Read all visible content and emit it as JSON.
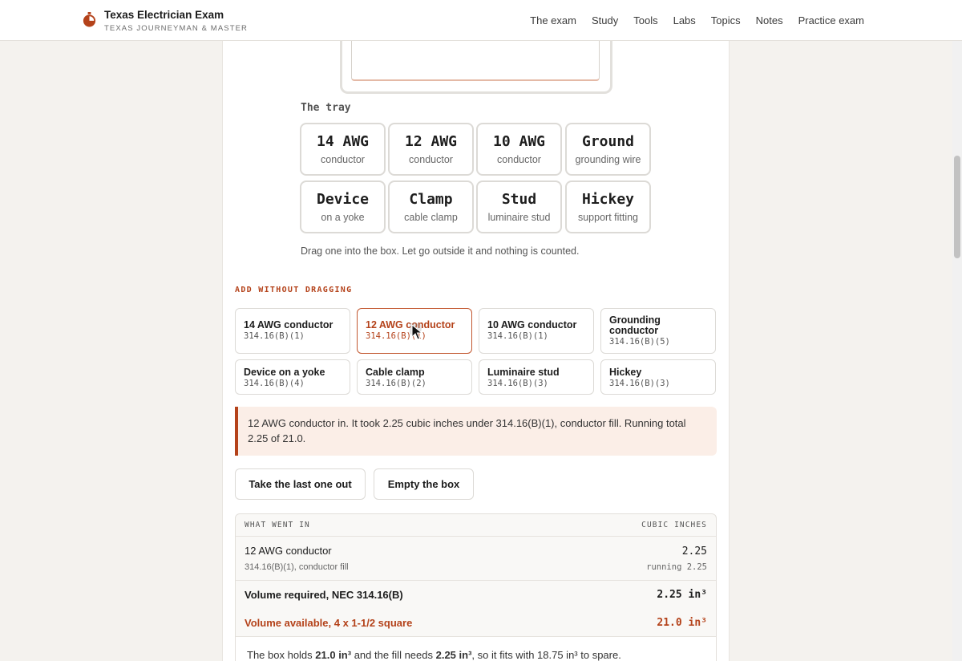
{
  "header": {
    "title": "Texas Electrician Exam",
    "subtitle": "TEXAS JOURNEYMAN & MASTER",
    "nav": [
      "The exam",
      "Study",
      "Tools",
      "Labs",
      "Topics",
      "Notes",
      "Practice exam"
    ]
  },
  "tray": {
    "label": "The tray",
    "tiles": [
      {
        "name": "14 AWG",
        "sub": "conductor"
      },
      {
        "name": "12 AWG",
        "sub": "conductor"
      },
      {
        "name": "10 AWG",
        "sub": "conductor"
      },
      {
        "name": "Ground",
        "sub": "grounding wire"
      },
      {
        "name": "Device",
        "sub": "on a yoke"
      },
      {
        "name": "Clamp",
        "sub": "cable clamp"
      },
      {
        "name": "Stud",
        "sub": "luminaire stud"
      },
      {
        "name": "Hickey",
        "sub": "support fitting"
      }
    ],
    "note": "Drag one into the box. Let go outside it and nothing is counted."
  },
  "add": {
    "label": "ADD WITHOUT DRAGGING",
    "buttons": [
      {
        "name": "14 AWG conductor",
        "ref": "314.16(B)(1)"
      },
      {
        "name": "12 AWG conductor",
        "ref": "314.16(B)(1)"
      },
      {
        "name": "10 AWG conductor",
        "ref": "314.16(B)(1)"
      },
      {
        "name": "Grounding conductor",
        "ref": "314.16(B)(5)"
      },
      {
        "name": "Device on a yoke",
        "ref": "314.16(B)(4)"
      },
      {
        "name": "Cable clamp",
        "ref": "314.16(B)(2)"
      },
      {
        "name": "Luminaire stud",
        "ref": "314.16(B)(3)"
      },
      {
        "name": "Hickey",
        "ref": "314.16(B)(3)"
      }
    ],
    "selected_index": 1
  },
  "status": "12 AWG conductor in. It took 2.25 cubic inches under 314.16(B)(1), conductor fill. Running total 2.25 of 21.0.",
  "actions": {
    "undo": "Take the last one out",
    "empty": "Empty the box"
  },
  "ledger": {
    "col_left": "WHAT WENT IN",
    "col_right": "CUBIC INCHES",
    "items": [
      {
        "name": "12 AWG conductor",
        "detail": "314.16(B)(1), conductor fill",
        "value": "2.25",
        "running": "running 2.25"
      }
    ],
    "required_label": "Volume required, NEC 314.16(B)",
    "required_value": "2.25 in³",
    "available_label": "Volume available, 4 x 1-1/2 square",
    "available_value": "21.0 in³",
    "summary": {
      "p1": "The box holds ",
      "holds": "21.0 in³",
      "p2": " and the fill needs ",
      "needs": "2.25 in³",
      "p3": ", so it fits with 18.75 in³ to spare."
    }
  },
  "colors": {
    "accent": "#b4421a",
    "accent_bg": "#fbeee7"
  }
}
